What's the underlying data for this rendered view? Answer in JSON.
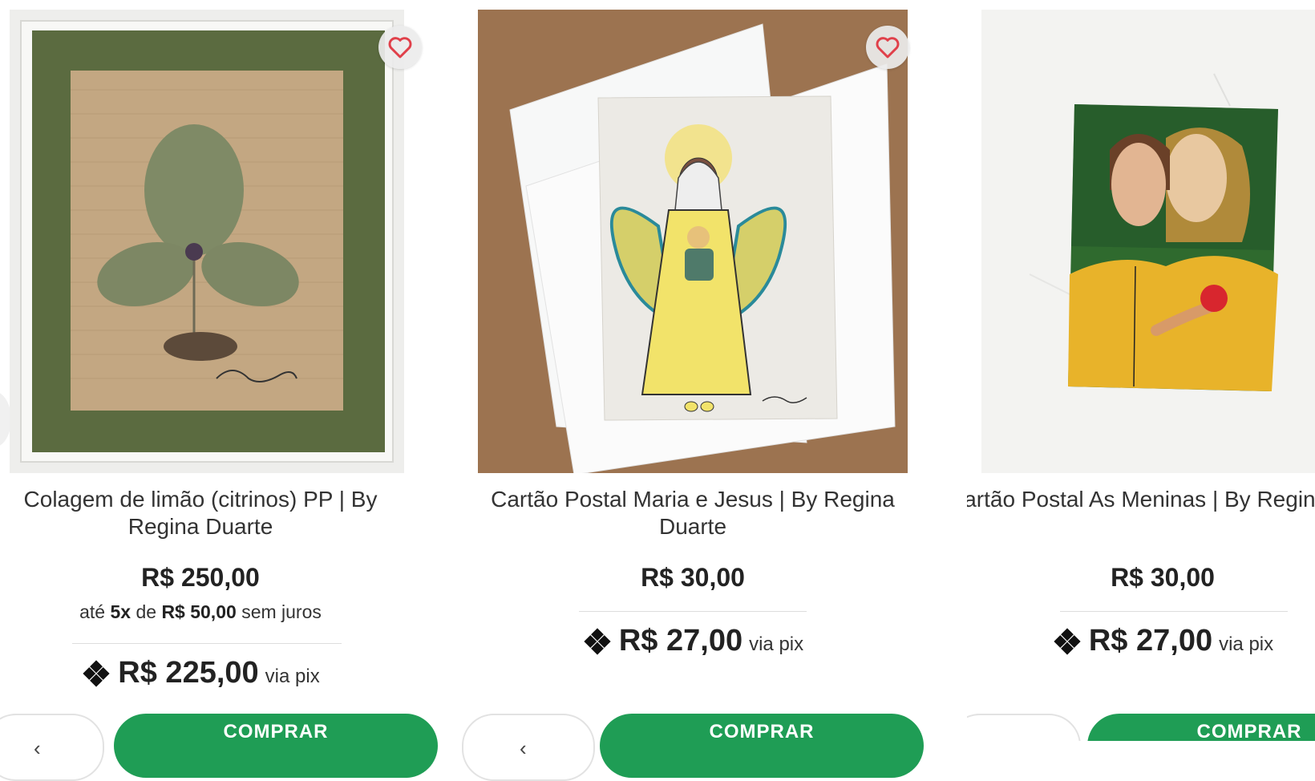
{
  "products": [
    {
      "name": "Colagem de limão (citrinos) PP | By Regina Duarte",
      "price": "R$ 250,00",
      "installment": {
        "prefix": "até",
        "count": "5x",
        "mid": "de",
        "value": "R$ 50,00",
        "suffix": "sem juros"
      },
      "pix_price": "R$ 225,00",
      "pix_label": "via pix",
      "buy_label": "COMPRAR"
    },
    {
      "name": "Cartão Postal Maria e Jesus | By Regina Duarte",
      "price": "R$ 30,00",
      "pix_price": "R$ 27,00",
      "pix_label": "via pix",
      "buy_label": "COMPRAR"
    },
    {
      "name": "Cartão Postal As Meninas | By Regina Duarte",
      "price": "R$ 30,00",
      "pix_price": "R$ 27,00",
      "pix_label": "via pix",
      "buy_label": "COMPRAR"
    }
  ],
  "icons": {
    "favorite": "heart-icon",
    "pix": "pix-icon",
    "carousel_prev": "chevron-left-icon"
  },
  "colors": {
    "buy_button": "#1f9d55",
    "heart": "#e0404a"
  }
}
